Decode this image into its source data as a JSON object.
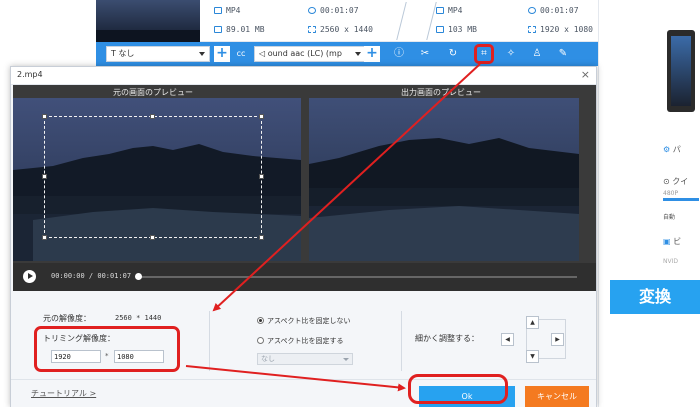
{
  "background": {
    "file": {
      "left": {
        "format": "MP4",
        "duration": "00:01:07",
        "size": "89.01 MB",
        "resolution": "2560 x 1440"
      },
      "right": {
        "format": "MP4",
        "duration": "00:01:07",
        "size": "103 MB",
        "resolution": "1920 x 1080"
      }
    },
    "toolbar": {
      "subtitle_select": "なし",
      "audio_select": "ound aac (LC) (mp"
    },
    "sidebar": {
      "video_label": "ビ",
      "quality_label": "クイ",
      "quality_value": "480P",
      "auto_label": "自動",
      "param_label": "パ",
      "nvidia_label": "NVID"
    },
    "convert_button": "変換"
  },
  "dialog": {
    "title": "2.mp4",
    "close": "×",
    "preview": {
      "original_label": "元の画面のプレビュー",
      "output_label": "出力画面のプレビュー",
      "time": "00:00:00 / 00:01:07"
    },
    "settings": {
      "original_resolution_label": "元の解像度：",
      "original_resolution_value": "2560 * 1440",
      "trim_resolution_label": "トリミング解像度：",
      "width": "1920",
      "times": "*",
      "height": "1080",
      "radio_no_fix": "アスペクト比を固定しない",
      "radio_fix": "アスペクト比を固定する",
      "aspect_select": "なし",
      "fine_adjust_label": "細かく調整する："
    },
    "footer": {
      "tutorial": "チュートリアル >",
      "ok": "Ok",
      "cancel": "キャンセル"
    }
  },
  "colors": {
    "accent": "#27a2f0",
    "cancel": "#f47a20",
    "annotation": "#e02020"
  }
}
